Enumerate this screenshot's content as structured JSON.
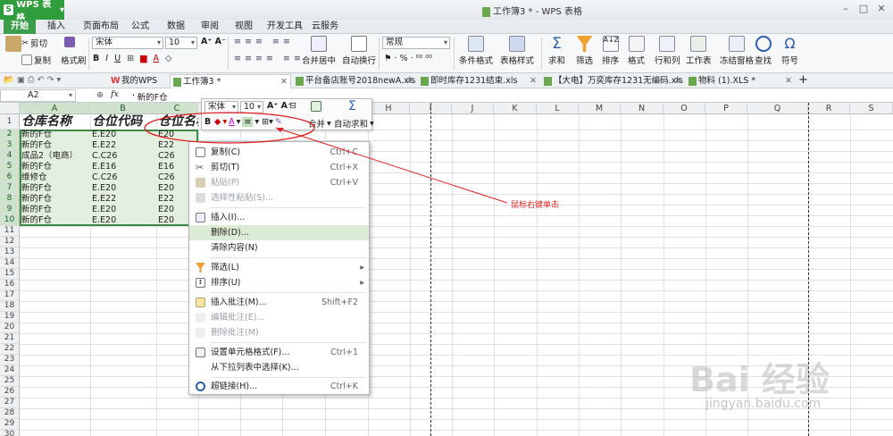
{
  "app": {
    "name": "WPS 表格",
    "window_title": "工作簿3 * - WPS 表格"
  },
  "menu": {
    "tabs": [
      "开始",
      "插入",
      "页面布局",
      "公式",
      "数据",
      "审阅",
      "视图",
      "开发工具",
      "云服务"
    ]
  },
  "ribbon": {
    "cut": "剪切",
    "copy": "复制",
    "format_painter": "格式刷",
    "font_name": "宋体",
    "font_size": "10",
    "merge_center": "合并居中",
    "auto_wrap": "自动换行",
    "number_format": "常规",
    "conditional_format": "条件格式",
    "table_style": "表格样式",
    "sum": "求和",
    "filter": "筛选",
    "sort": "排序",
    "format": "格式",
    "rows_cols": "行和列",
    "worksheet": "工作表",
    "freeze": "冻结窗格",
    "find": "查找",
    "symbol": "符号"
  },
  "doc_tabs": [
    {
      "label": "我的WPS"
    },
    {
      "label": "工作簿3 *"
    },
    {
      "label": "平台备店账号2018newA.xlsx *"
    },
    {
      "label": "即时库存1231结束.xls"
    },
    {
      "label": "【大电】万奕库存1231无编码.xls *"
    },
    {
      "label": "物料 (1).XLS *"
    }
  ],
  "formula": {
    "cell_ref": "A2",
    "fx": "fx",
    "value": "' 新的F仓"
  },
  "grid": {
    "columns": [
      "A",
      "B",
      "C",
      "D",
      "E",
      "F",
      "G",
      "H",
      "I",
      "J",
      "K",
      "L",
      "M",
      "N",
      "O",
      "P",
      "Q",
      "R",
      "S"
    ],
    "rows": [
      "1",
      "2",
      "3",
      "4",
      "5",
      "6",
      "7",
      "8",
      "9",
      "10",
      "11",
      "12",
      "13",
      "14",
      "15",
      "16",
      "17",
      "18",
      "19",
      "20",
      "21",
      "22",
      "23",
      "24",
      "25",
      "26",
      "27",
      "28",
      "29",
      "30"
    ],
    "headers": [
      "仓库名称",
      "仓位代码",
      "仓位名称"
    ],
    "data": [
      [
        "新的F仓",
        "E.E20",
        "E20"
      ],
      [
        "新的F仓",
        "E.E22",
        "E22"
      ],
      [
        "成品2（电商）",
        "C.C26",
        "C26"
      ],
      [
        "新的F仓",
        "E.E16",
        "E16"
      ],
      [
        "维修仓",
        "C.C26",
        "C26"
      ],
      [
        "新的F仓",
        "E.E20",
        "E20"
      ],
      [
        "新的F仓",
        "E.E22",
        "E22"
      ],
      [
        "新的F仓",
        "E.E20",
        "E20"
      ],
      [
        "新的F仓",
        "E.E20",
        "E20"
      ]
    ]
  },
  "mini_toolbar": {
    "font": "宋体",
    "size": "10",
    "bold": "B",
    "merge": "合并",
    "autosum": "自动求和"
  },
  "context_menu": [
    {
      "label": "复制(C)",
      "shortcut": "Ctrl+C",
      "disabled": false
    },
    {
      "label": "剪切(T)",
      "shortcut": "Ctrl+X",
      "disabled": false
    },
    {
      "label": "粘贴(P)",
      "shortcut": "Ctrl+V",
      "disabled": true
    },
    {
      "label": "选择性粘贴(S)...",
      "shortcut": "",
      "disabled": true
    },
    {
      "label": "插入(I)...",
      "shortcut": "",
      "disabled": false
    },
    {
      "label": "删除(D)...",
      "shortcut": "",
      "disabled": false
    },
    {
      "label": "清除内容(N)",
      "shortcut": "",
      "disabled": false
    },
    {
      "label": "筛选(L)",
      "shortcut": "",
      "disabled": false
    },
    {
      "label": "排序(U)",
      "shortcut": "",
      "disabled": false
    },
    {
      "label": "插入批注(M)...",
      "shortcut": "Shift+F2",
      "disabled": false
    },
    {
      "label": "编辑批注(E)...",
      "shortcut": "",
      "disabled": true
    },
    {
      "label": "删除批注(M)",
      "shortcut": "",
      "disabled": true
    },
    {
      "label": "设置单元格格式(F)...",
      "shortcut": "Ctrl+1",
      "disabled": false
    },
    {
      "label": "从下拉列表中选择(K)...",
      "shortcut": "",
      "disabled": false
    },
    {
      "label": "超链接(H)...",
      "shortcut": "Ctrl+K",
      "disabled": false
    }
  ],
  "annotation": "鼠标右键单击",
  "watermark": {
    "text": "Bai 经验",
    "url": "jingyan.baidu.com"
  },
  "colors": {
    "accent": "#2f9d3c",
    "selection": "#dcebd4",
    "annotation": "#e02020"
  }
}
